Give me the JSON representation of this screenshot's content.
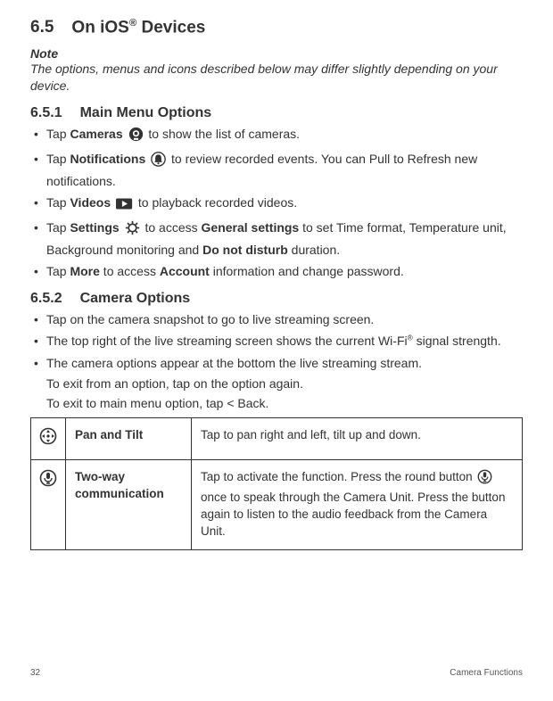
{
  "section": {
    "number": "6.5",
    "title_pre": "On iOS",
    "title_post": " Devices",
    "reg": "®"
  },
  "note": {
    "label": "Note",
    "body": "The options, menus and icons described below may differ slightly depending on your device."
  },
  "sub1": {
    "number": "6.5.1",
    "title": "Main Menu Options",
    "items": {
      "cameras": {
        "prefix": "Tap ",
        "label": "Cameras",
        "suffix": " to show the list of cameras."
      },
      "notifications": {
        "prefix": "Tap ",
        "label": "Notifications",
        "suffix": " to review recorded events. You can Pull to Refresh new notifications."
      },
      "videos": {
        "prefix": "Tap ",
        "label": "Videos",
        "suffix": " to playback recorded videos."
      },
      "settings": {
        "prefix": "Tap ",
        "label": "Settings",
        "mid1": " to access ",
        "bold2": "General settings",
        "mid2": " to set Time format, Temperature unit, Background monitoring and ",
        "bold3": "Do not disturb",
        "suffix": " duration."
      },
      "more": {
        "prefix": "Tap ",
        "label": "More",
        "mid": " to access ",
        "bold2": "Account",
        "suffix": " information and change password."
      }
    }
  },
  "sub2": {
    "number": "6.5.2",
    "title": "Camera Options",
    "items": {
      "snapshot": "Tap on the camera snapshot to go to live streaming screen.",
      "wifi_pre": "The top right of the live streaming screen shows the current Wi-Fi",
      "wifi_post": " signal strength.",
      "bottom": "The camera options appear at the bottom the live streaming stream."
    },
    "exit1": "To exit from an option, tap on the option again.",
    "exit2_pre": "To exit to main menu option, tap ",
    "exit2_bold": "<  Back",
    "exit2_post": "."
  },
  "table": {
    "rows": {
      "pan": {
        "name": "Pan and Tilt",
        "desc": "Tap to pan right and left, tilt up and down."
      },
      "twoway": {
        "name": "Two-way communication",
        "desc_a": "Tap to activate the function. Press the round button ",
        "desc_b": " once to speak through the Camera Unit. Press the button again to listen to the audio feedback from the Camera Unit."
      }
    }
  },
  "footer": {
    "page": "32",
    "section": "Camera Functions"
  }
}
